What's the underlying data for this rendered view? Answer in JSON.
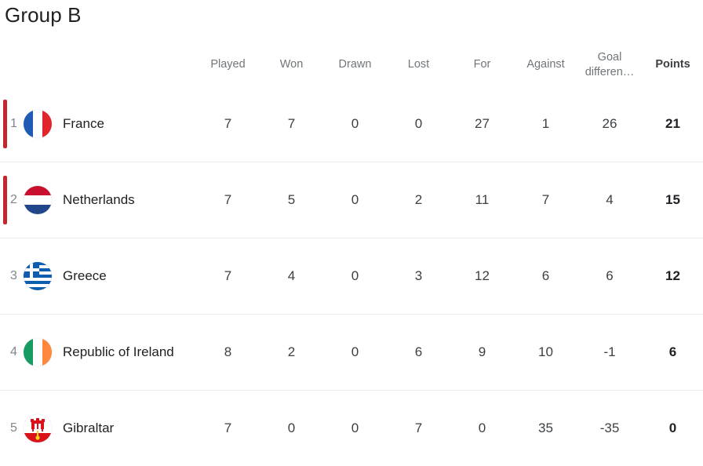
{
  "title": "Group B",
  "table": {
    "columns": [
      {
        "key": "team",
        "label": ""
      },
      {
        "key": "played",
        "label": "Played"
      },
      {
        "key": "won",
        "label": "Won"
      },
      {
        "key": "drawn",
        "label": "Drawn"
      },
      {
        "key": "lost",
        "label": "Lost"
      },
      {
        "key": "for",
        "label": "For"
      },
      {
        "key": "against",
        "label": "Against"
      },
      {
        "key": "gd",
        "label": "Goal differen…",
        "line1": "Goal",
        "line2": "differen…"
      },
      {
        "key": "points",
        "label": "Points"
      }
    ],
    "rows": [
      {
        "rank": "1",
        "team": "France",
        "flag": "flag-france-icon",
        "qualified": true,
        "played": "7",
        "won": "7",
        "drawn": "0",
        "lost": "0",
        "for": "27",
        "against": "1",
        "gd": "26",
        "points": "21"
      },
      {
        "rank": "2",
        "team": "Netherlands",
        "flag": "flag-netherlands-icon",
        "qualified": true,
        "played": "7",
        "won": "5",
        "drawn": "0",
        "lost": "2",
        "for": "11",
        "against": "7",
        "gd": "4",
        "points": "15"
      },
      {
        "rank": "3",
        "team": "Greece",
        "flag": "flag-greece-icon",
        "qualified": false,
        "played": "7",
        "won": "4",
        "drawn": "0",
        "lost": "3",
        "for": "12",
        "against": "6",
        "gd": "6",
        "points": "12"
      },
      {
        "rank": "4",
        "team": "Republic of Ireland",
        "flag": "flag-ireland-icon",
        "qualified": false,
        "played": "8",
        "won": "2",
        "drawn": "0",
        "lost": "6",
        "for": "9",
        "against": "10",
        "gd": "-1",
        "points": "6"
      },
      {
        "rank": "5",
        "team": "Gibraltar",
        "flag": "flag-gibraltar-icon",
        "qualified": false,
        "played": "7",
        "won": "0",
        "drawn": "0",
        "lost": "7",
        "for": "0",
        "against": "35",
        "gd": "-35",
        "points": "0"
      }
    ]
  },
  "colors": {
    "qualification_marker": "#c5252c",
    "header_text": "#70757a",
    "body_text": "#3c4043",
    "divider": "#ebebeb"
  }
}
